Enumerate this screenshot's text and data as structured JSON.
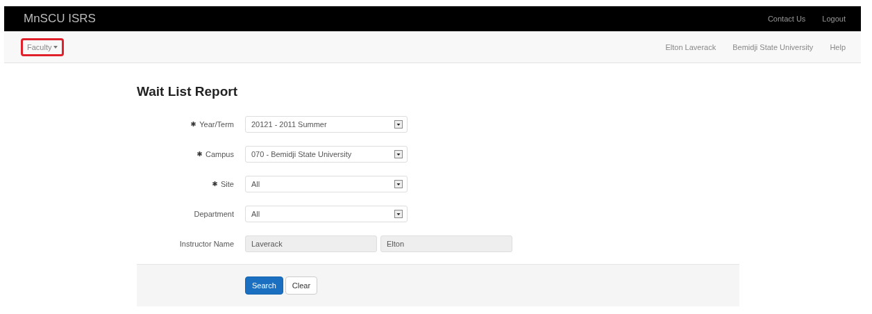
{
  "navbar": {
    "brand": "MnSCU ISRS",
    "links": [
      "Contact Us",
      "Logout"
    ]
  },
  "subnav": {
    "menu": {
      "label": "Faculty",
      "highlighted": true
    },
    "items": [
      "Elton Laverack",
      "Bemidji State University",
      "Help"
    ]
  },
  "form": {
    "title": "Wait List Report",
    "fields": [
      {
        "kind": "select",
        "label": "Year/Term",
        "required": true,
        "value": "20121 - 2011 Summer"
      },
      {
        "kind": "select",
        "label": "Campus",
        "required": true,
        "value": "070 - Bemidji State University"
      },
      {
        "kind": "select",
        "label": "Site",
        "required": true,
        "value": "All"
      },
      {
        "kind": "select",
        "label": "Department",
        "required": false,
        "value": "All"
      },
      {
        "kind": "names",
        "label": "Instructor Name",
        "required": false,
        "values": [
          "Laverack",
          "Elton"
        ]
      }
    ],
    "buttons": [
      {
        "label": "Search",
        "primary": true
      },
      {
        "label": "Clear",
        "primary": false
      }
    ]
  }
}
